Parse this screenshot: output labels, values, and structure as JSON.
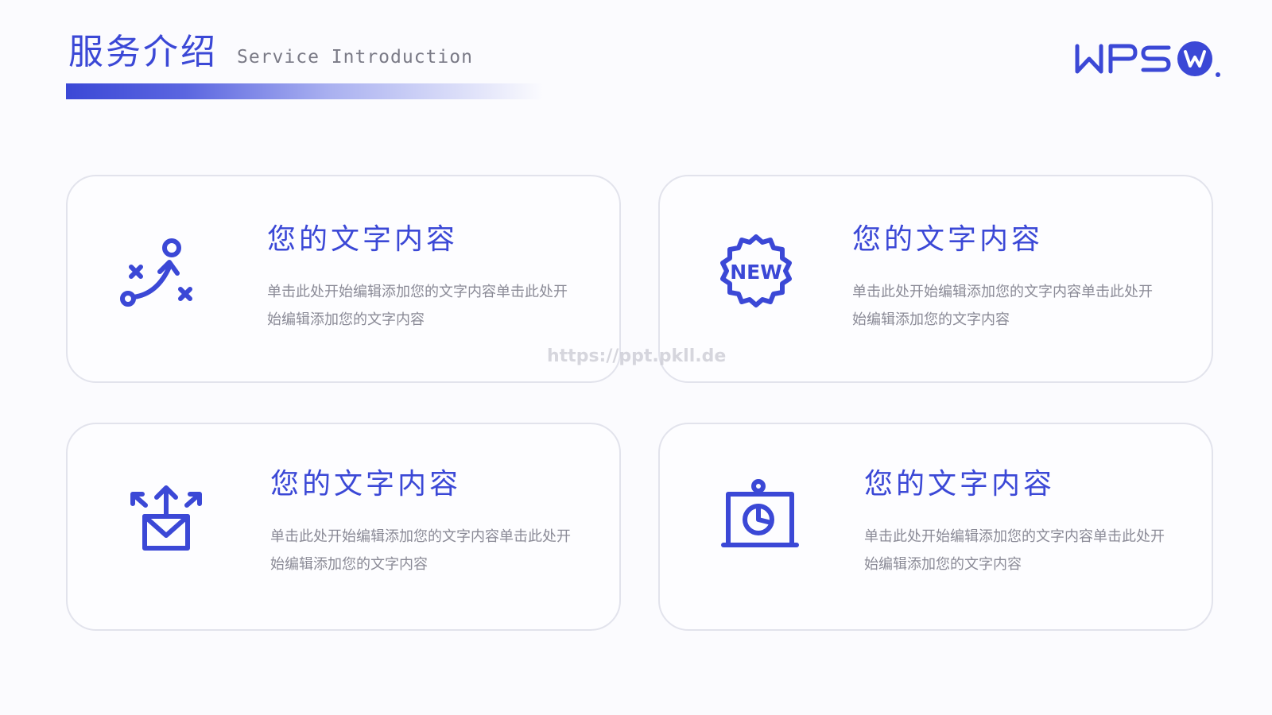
{
  "header": {
    "title": "服务介绍",
    "subtitle": "Service Introduction"
  },
  "logo": {
    "text": "WPS",
    "accent_color": "#3b48d6"
  },
  "cards": [
    {
      "title": "您的文字内容",
      "description": "单击此处开始编辑添加您的文字内容单击此处开始编辑添加您的文字内容",
      "icon": "strategy-path-icon"
    },
    {
      "title": "您的文字内容",
      "description": "单击此处开始编辑添加您的文字内容单击此处开始编辑添加您的文字内容",
      "icon": "new-badge-icon",
      "icon_label": "NEW"
    },
    {
      "title": "您的文字内容",
      "description": "单击此处开始编辑添加您的文字内容单击此处开始编辑添加您的文字内容",
      "icon": "mail-outbound-icon"
    },
    {
      "title": "您的文字内容",
      "description": "单击此处开始编辑添加您的文字内容单击此处开始编辑添加您的文字内容",
      "icon": "presentation-chart-icon"
    }
  ],
  "watermark": {
    "text": "https://ppt.pkll.de"
  },
  "colors": {
    "accent": "#3b48d6",
    "card_border": "#e2e3ec",
    "body_text": "#8a8a96"
  }
}
